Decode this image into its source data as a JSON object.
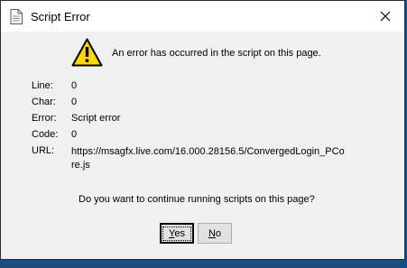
{
  "window": {
    "title": "Script Error"
  },
  "icons": {
    "title_icon": "document-icon",
    "warning_icon": "warning-icon",
    "close_icon": "close-icon"
  },
  "message": "An error has occurred in the script on this page.",
  "details": {
    "line_label": "Line:",
    "line_value": "0",
    "char_label": "Char:",
    "char_value": "0",
    "error_label": "Error:",
    "error_value": "Script error",
    "code_label": "Code:",
    "code_value": "0",
    "url_label": "URL:",
    "url_value": "https://msagfx.live.com/16.000.28156.5/ConvergedLogin_PCore.js"
  },
  "question": "Do you want to continue running scripts on this page?",
  "buttons": {
    "yes_first": "Y",
    "yes_rest": "es",
    "no_first": "N",
    "no_rest": "o"
  },
  "colors": {
    "desktop": "#1a4d82",
    "dialog_bg": "#f0f0f0",
    "warning_yellow": "#ffd800"
  }
}
